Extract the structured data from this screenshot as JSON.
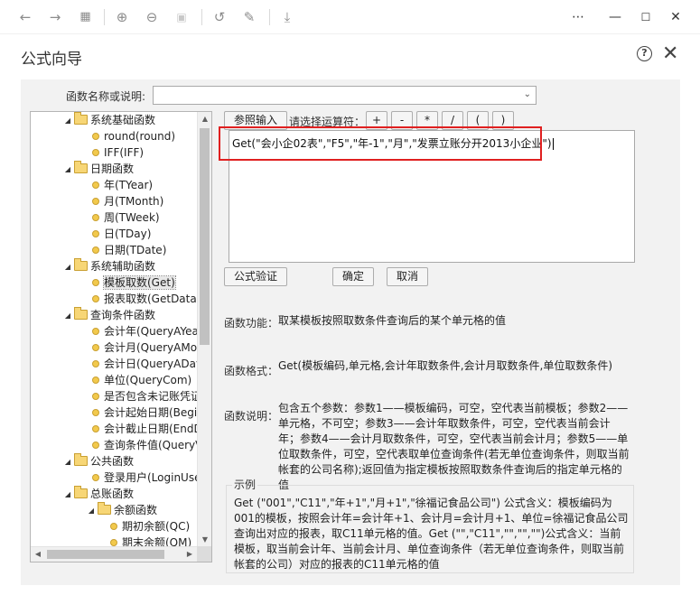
{
  "toolbar": {
    "icons": [
      "arrow-left-icon",
      "arrow-right-icon",
      "grid-icon",
      "zoom-in-icon",
      "zoom-out-icon",
      "fit-page-icon",
      "rotate-icon",
      "edit-icon",
      "save-icon"
    ],
    "window_controls": [
      "more-icon",
      "minimize-icon",
      "maximize-icon",
      "close-icon"
    ]
  },
  "dialog": {
    "title": "公式向导",
    "help_symbol": "?",
    "close_symbol": "✕"
  },
  "function_name": {
    "label": "函数名称或说明:",
    "value": ""
  },
  "tree": {
    "items": [
      {
        "label": "系统基础函数",
        "level": 0,
        "type": "folder",
        "expanded": true
      },
      {
        "label": "round(round)",
        "level": 1,
        "type": "leaf"
      },
      {
        "label": "IFF(IFF)",
        "level": 1,
        "type": "leaf"
      },
      {
        "label": "日期函数",
        "level": 0,
        "type": "folder",
        "expanded": true
      },
      {
        "label": "年(TYear)",
        "level": 1,
        "type": "leaf"
      },
      {
        "label": "月(TMonth)",
        "level": 1,
        "type": "leaf"
      },
      {
        "label": "周(TWeek)",
        "level": 1,
        "type": "leaf"
      },
      {
        "label": "日(TDay)",
        "level": 1,
        "type": "leaf"
      },
      {
        "label": "日期(TDate)",
        "level": 1,
        "type": "leaf"
      },
      {
        "label": "系统辅助函数",
        "level": 0,
        "type": "folder",
        "expanded": true
      },
      {
        "label": "模板取数(Get)",
        "level": 1,
        "type": "leaf",
        "selected": true
      },
      {
        "label": "报表取数(GetData)",
        "level": 1,
        "type": "leaf"
      },
      {
        "label": "查询条件函数",
        "level": 0,
        "type": "folder",
        "expanded": true
      },
      {
        "label": "会计年(QueryAYear)",
        "level": 1,
        "type": "leaf"
      },
      {
        "label": "会计月(QueryAMonth)",
        "level": 1,
        "type": "leaf"
      },
      {
        "label": "会计日(QueryADay)",
        "level": 1,
        "type": "leaf"
      },
      {
        "label": "单位(QueryCom)",
        "level": 1,
        "type": "leaf"
      },
      {
        "label": "是否包含未记账凭证",
        "level": 1,
        "type": "leaf"
      },
      {
        "label": "会计起始日期(BeginDate)",
        "level": 1,
        "type": "leaf"
      },
      {
        "label": "会计截止日期(EndDate)",
        "level": 1,
        "type": "leaf"
      },
      {
        "label": "查询条件值(QueryValue)",
        "level": 1,
        "type": "leaf"
      },
      {
        "label": "公共函数",
        "level": 0,
        "type": "folder",
        "expanded": true
      },
      {
        "label": "登录用户(LoginUser)",
        "level": 1,
        "type": "leaf"
      },
      {
        "label": "总账函数",
        "level": 0,
        "type": "folder",
        "expanded": true
      },
      {
        "label": "余额函数",
        "level": 1,
        "type": "folder",
        "expanded": true
      },
      {
        "label": "期初余额(QC)",
        "level": 2,
        "type": "leaf"
      },
      {
        "label": "期末余额(QM)",
        "level": 2,
        "type": "leaf"
      }
    ]
  },
  "buttons": {
    "reference_input": "参照输入",
    "operator_label": "请选择运算符：",
    "operators": [
      "+",
      "-",
      "*",
      "/",
      "(",
      ")"
    ],
    "validate": "公式验证",
    "ok": "确定",
    "cancel": "取消"
  },
  "formula": {
    "value": "Get(\"会小企02表\",\"F5\",\"年-1\",\"月\",\"发票立账分开2013小企业\")"
  },
  "info": {
    "function_label": "函数功能：",
    "function_text": "取某模板按照取数条件查询后的某个单元格的值",
    "format_label": "函数格式：",
    "format_text": "Get(模板编码,单元格,会计年取数条件,会计月取数条件,单位取数条件)",
    "desc_label": "函数说明：",
    "desc_text": "包含五个参数：参数1——模板编码，可空，空代表当前模板；参数2——单元格，不可空；参数3——会计年取数条件，可空，空代表当前会计年；参数4——会计月取数条件，可空，空代表当前会计月；参数5——单位取数条件，可空，空代表取单位查询条件(若无单位查询条件，则取当前帐套的公司名称);返回值为指定模板按照取数条件查询后的指定单元格的值"
  },
  "example": {
    "legend": "示例",
    "text": "Get (\"001\",\"C11\",\"年+1\",\"月+1\",\"徐福记食品公司\") 公式含义：模板编码为001的模板，按照会计年=会计年+1、会计月=会计月+1、单位=徐福记食品公司查询出对应的报表，取C11单元格的值。Get (\"\",\"C11\",\"\",\"\",\"\")公式含义：当前模板，取当前会计年、当前会计月、单位查询条件（若无单位查询条件，则取当前帐套的公司）对应的报表的C11单元格的值"
  }
}
